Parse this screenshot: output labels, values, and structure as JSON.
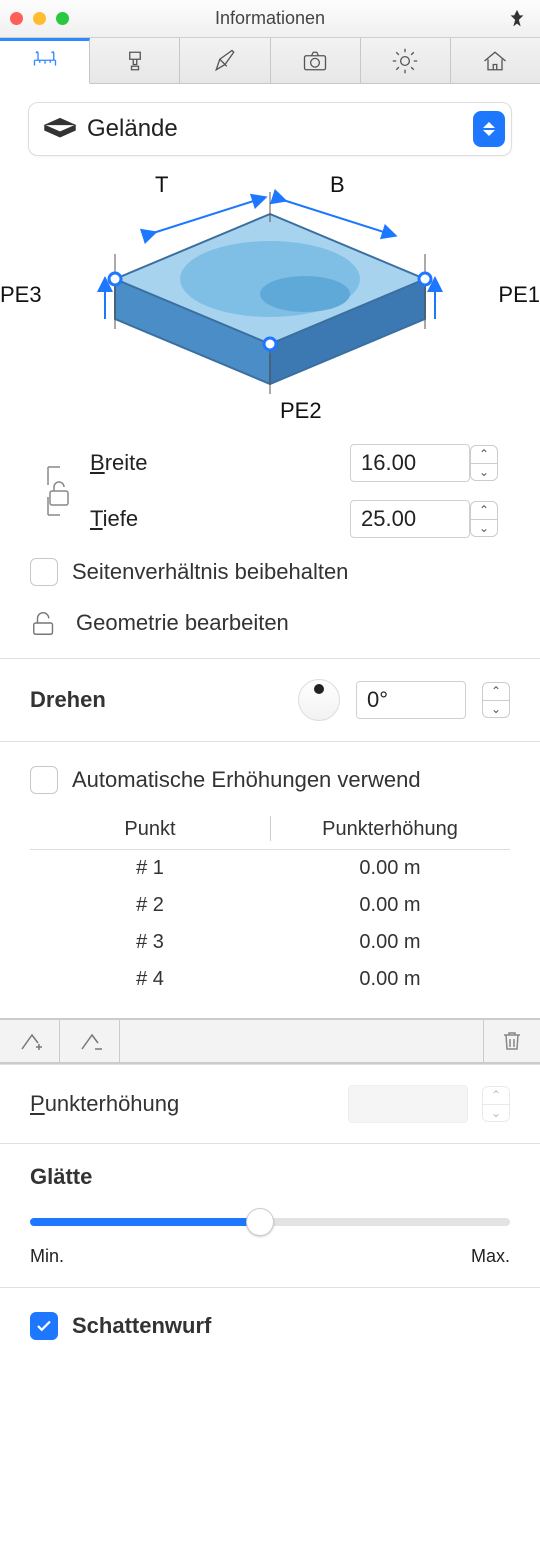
{
  "window": {
    "title": "Informationen"
  },
  "tabs": {
    "icons": [
      "ruler-icon",
      "brush-icon",
      "pencil-icon",
      "camera-icon",
      "sun-icon",
      "house-icon"
    ]
  },
  "object_select": {
    "value": "Gelände",
    "icon": "terrain-icon"
  },
  "diagram": {
    "labels": {
      "t": "T",
      "b": "B",
      "pe1": "PE1",
      "pe2": "PE2",
      "pe3": "PE3"
    }
  },
  "dimensions": {
    "breite_label": "Breite",
    "tiefe_label": "Tiefe",
    "breite": "16.00",
    "tiefe": "25.00",
    "aspect_label": "Seitenverhältnis beibehalten",
    "aspect_checked": false,
    "geometry_label": "Geometrie bearbeiten"
  },
  "rotate": {
    "label": "Drehen",
    "value": "0°"
  },
  "elevations": {
    "auto_label": "Automatische Erhöhungen verwend",
    "auto_checked": false,
    "col1": "Punkt",
    "col2": "Punkterhöhung",
    "rows": [
      {
        "point": "# 1",
        "elev": "0.00 m"
      },
      {
        "point": "# 2",
        "elev": "0.00 m"
      },
      {
        "point": "# 3",
        "elev": "0.00 m"
      },
      {
        "point": "# 4",
        "elev": "0.00 m"
      }
    ]
  },
  "point_elevation": {
    "label": "Punkterhöhung",
    "value": ""
  },
  "smoothness": {
    "label": "Glätte",
    "min": "Min.",
    "max": "Max."
  },
  "shadow": {
    "label": "Schattenwurf",
    "checked": true
  }
}
